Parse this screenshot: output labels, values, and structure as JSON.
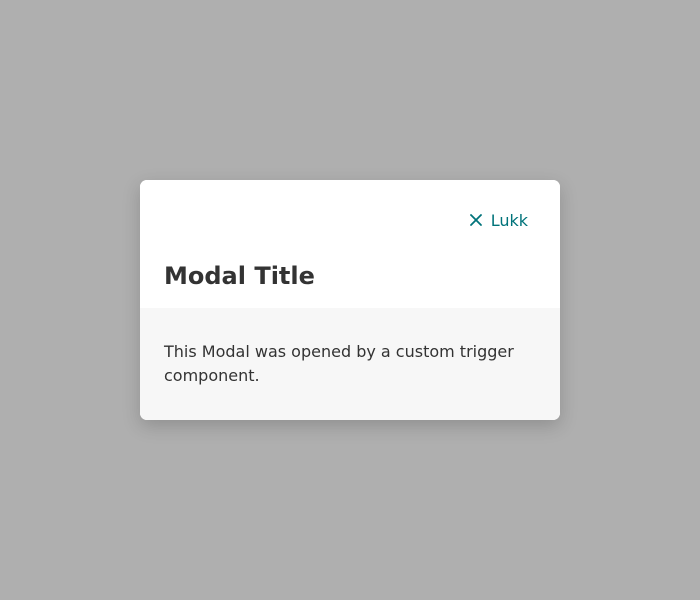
{
  "backdrop": {
    "color": "#afafaf"
  },
  "modal": {
    "close_label": "Lukk",
    "close_icon": "close-icon",
    "title": "Modal Title",
    "body_text": "This Modal was opened by a custom trigger component.",
    "accent_color": "#00737a",
    "body_background": "#f7f7f7"
  }
}
